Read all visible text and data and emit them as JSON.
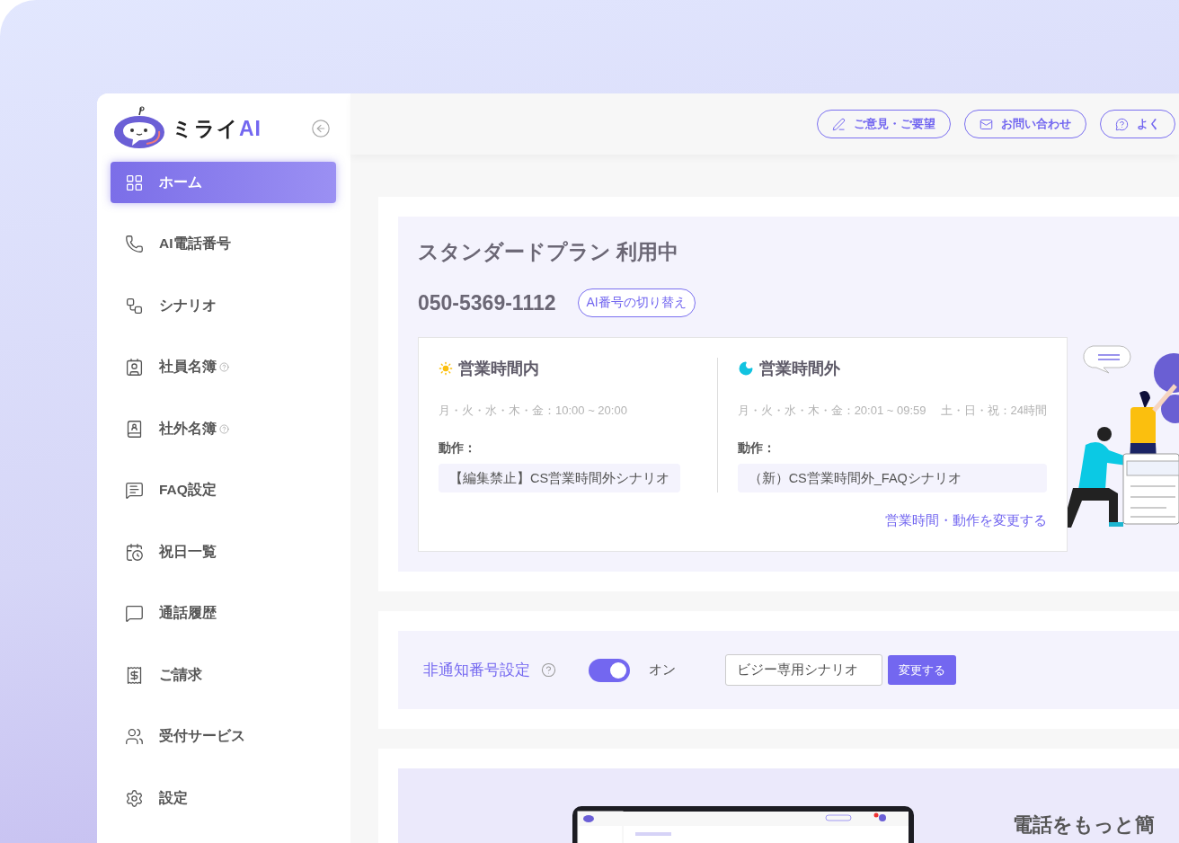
{
  "brand": {
    "name": "ミライ",
    "suffix": "AI"
  },
  "sidebar": {
    "items": [
      {
        "label": "ホーム",
        "selected": true,
        "help": false
      },
      {
        "label": "AI電話番号",
        "selected": false,
        "help": false
      },
      {
        "label": "シナリオ",
        "selected": false,
        "help": false
      },
      {
        "label": "社員名簿",
        "selected": false,
        "help": true
      },
      {
        "label": "社外名簿",
        "selected": false,
        "help": true
      },
      {
        "label": "FAQ設定",
        "selected": false,
        "help": false
      },
      {
        "label": "祝日一覧",
        "selected": false,
        "help": false
      },
      {
        "label": "通話履歴",
        "selected": false,
        "help": false
      },
      {
        "label": "ご請求",
        "selected": false,
        "help": false
      },
      {
        "label": "受付サービス",
        "selected": false,
        "help": false
      },
      {
        "label": "設定",
        "selected": false,
        "help": false
      }
    ]
  },
  "header": {
    "buttons": [
      "ご意見・ご要望",
      "お問い合わせ",
      "よく"
    ]
  },
  "plan": {
    "title": "スタンダードプラン 利用中",
    "phone": "050-5369-1112",
    "switch_button": "AI番号の切り替え"
  },
  "hours": [
    {
      "kind": "day",
      "title": "営業時間内",
      "schedule": [
        "月・火・水・木・金：10:00 ~ 20:00"
      ],
      "action_label": "動作：",
      "action": "【編集禁止】CS営業時間外シナリオ"
    },
    {
      "kind": "night",
      "title": "営業時間外",
      "schedule": [
        "月・火・水・木・金：20:01 ~ 09:59",
        "土・日・祝：24時間"
      ],
      "action_label": "動作：",
      "action": "（新）CS営業時間外_FAQシナリオ"
    }
  ],
  "change_link": "営業時間・動作を変更する",
  "unlisted_number": {
    "label": "非通知番号設定",
    "on": true,
    "state_label": "オン",
    "scenario": "ビジー専用シナリオ",
    "button": "変更する"
  },
  "promo": {
    "heading": "電話をもっと簡"
  }
}
